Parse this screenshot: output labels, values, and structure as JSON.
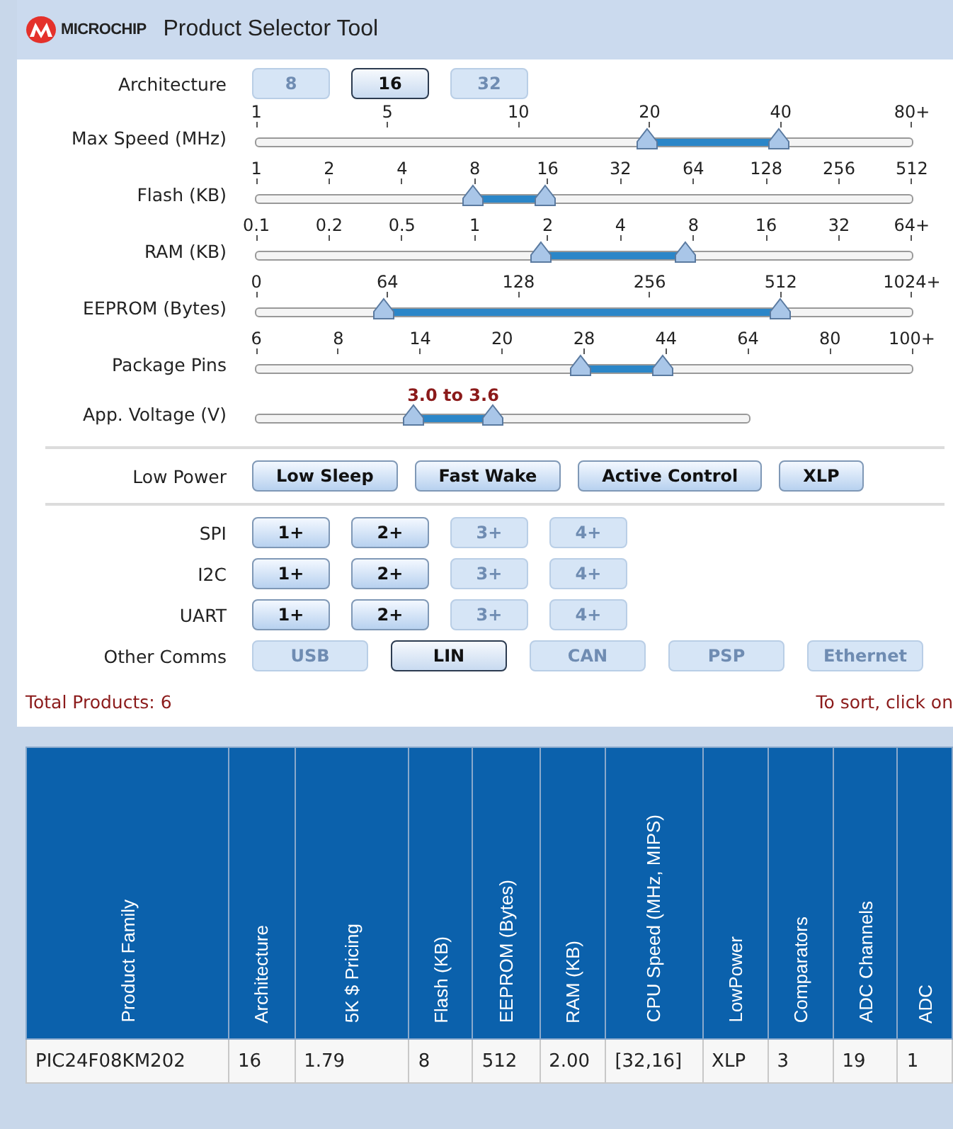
{
  "header": {
    "logo_text": "MICROCHIP",
    "title": "Product Selector Tool"
  },
  "architecture": {
    "label": "Architecture",
    "options": [
      {
        "label": "8",
        "selected": false,
        "disabled": true
      },
      {
        "label": "16",
        "selected": true,
        "disabled": false
      },
      {
        "label": "32",
        "selected": false,
        "disabled": true
      }
    ]
  },
  "sliders": [
    {
      "label": "Max Speed (MHz)",
      "ticks": [
        "1",
        "5",
        "10",
        "20",
        "40",
        "80+"
      ],
      "thumbs": [
        {
          "level": 0.596
        },
        {
          "level": 0.797
        }
      ]
    },
    {
      "label": "Flash (KB)",
      "ticks": [
        "1",
        "2",
        "4",
        "8",
        "16",
        "32",
        "64",
        "128",
        "256",
        "512"
      ],
      "thumbs": [
        {
          "level": 0.33
        },
        {
          "level": 0.44
        }
      ]
    },
    {
      "label": "RAM (KB)",
      "ticks": [
        "0.1",
        "0.2",
        "0.5",
        "1",
        "2",
        "4",
        "8",
        "16",
        "32",
        "64+"
      ],
      "thumbs": [
        {
          "level": 0.435
        },
        {
          "level": 0.655
        }
      ]
    },
    {
      "label": "EEPROM (Bytes)",
      "ticks": [
        "0",
        "64",
        "128",
        "256",
        "512",
        "1024+"
      ],
      "thumbs": [
        {
          "level": 0.195
        },
        {
          "level": 0.8
        }
      ]
    },
    {
      "label": "Package Pins",
      "ticks": [
        "6",
        "8",
        "14",
        "20",
        "28",
        "44",
        "64",
        "80",
        "100+"
      ],
      "thumbs": [
        {
          "level": 0.495
        },
        {
          "level": 0.62
        }
      ]
    }
  ],
  "voltage": {
    "label": "App. Voltage (V)",
    "reading": "3.0 to 3.6",
    "thumbs": [
      {
        "level": 0.32
      },
      {
        "level": 0.48
      }
    ]
  },
  "low_power": {
    "label": "Low Power",
    "options": [
      {
        "label": "Low Sleep",
        "selected": false,
        "disabled": false
      },
      {
        "label": "Fast Wake",
        "selected": false,
        "disabled": false
      },
      {
        "label": "Active Control",
        "selected": false,
        "disabled": false
      },
      {
        "label": "XLP",
        "selected": false,
        "disabled": false
      }
    ]
  },
  "comms": [
    {
      "label": "SPI",
      "options": [
        {
          "label": "1+",
          "selected": false,
          "disabled": false
        },
        {
          "label": "2+",
          "selected": false,
          "disabled": false
        },
        {
          "label": "3+",
          "selected": false,
          "disabled": true
        },
        {
          "label": "4+",
          "selected": false,
          "disabled": true
        }
      ]
    },
    {
      "label": "I2C",
      "options": [
        {
          "label": "1+",
          "selected": false,
          "disabled": false
        },
        {
          "label": "2+",
          "selected": false,
          "disabled": false
        },
        {
          "label": "3+",
          "selected": false,
          "disabled": true
        },
        {
          "label": "4+",
          "selected": false,
          "disabled": true
        }
      ]
    },
    {
      "label": "UART",
      "options": [
        {
          "label": "1+",
          "selected": false,
          "disabled": false
        },
        {
          "label": "2+",
          "selected": false,
          "disabled": false
        },
        {
          "label": "3+",
          "selected": false,
          "disabled": true
        },
        {
          "label": "4+",
          "selected": false,
          "disabled": true
        }
      ]
    }
  ],
  "other_comms": {
    "label": "Other Comms",
    "options": [
      {
        "label": "USB",
        "selected": false,
        "disabled": true
      },
      {
        "label": "LIN",
        "selected": true,
        "disabled": false
      },
      {
        "label": "CAN",
        "selected": false,
        "disabled": true
      },
      {
        "label": "PSP",
        "selected": false,
        "disabled": true
      },
      {
        "label": "Ethernet",
        "selected": false,
        "disabled": true
      }
    ]
  },
  "total_products": "Total Products: 6",
  "sort_hint": "To sort, click on",
  "table": {
    "columns": [
      "Product Family",
      "Architecture",
      "5K $ Pricing",
      "Flash (KB)",
      "EEPROM (Bytes)",
      "RAM (KB)",
      "CPU Speed (MHz, MIPS)",
      "LowPower",
      "Comparators",
      "ADC Channels",
      "ADC"
    ],
    "rows": [
      [
        "PIC24F08KM202",
        "16",
        "1.79",
        "8",
        "512",
        "2.00",
        "[32,16]",
        "XLP",
        "3",
        "19",
        "1"
      ]
    ]
  }
}
